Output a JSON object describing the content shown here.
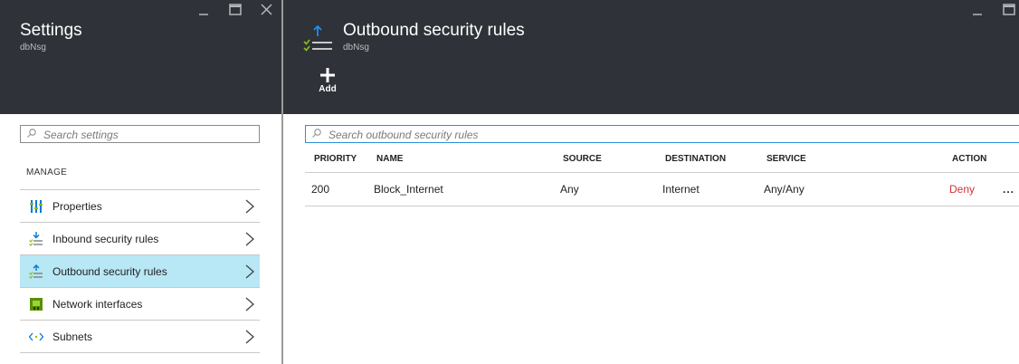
{
  "left_blade": {
    "title": "Settings",
    "subtitle": "dbNsg",
    "search_placeholder": "Search settings",
    "section_label": "MANAGE",
    "menu": [
      {
        "label": "Properties",
        "icon": "properties-icon"
      },
      {
        "label": "Inbound security rules",
        "icon": "inbound-rules-icon"
      },
      {
        "label": "Outbound security rules",
        "icon": "outbound-rules-icon",
        "selected": true
      },
      {
        "label": "Network interfaces",
        "icon": "network-interface-icon"
      },
      {
        "label": "Subnets",
        "icon": "subnet-icon"
      }
    ]
  },
  "right_blade": {
    "title": "Outbound security rules",
    "subtitle": "dbNsg",
    "add_label": "Add",
    "search_placeholder": "Search outbound security rules",
    "table": {
      "headers": [
        "PRIORITY",
        "NAME",
        "SOURCE",
        "DESTINATION",
        "SERVICE",
        "ACTION"
      ],
      "rows": [
        {
          "priority": "200",
          "name": "Block_Internet",
          "source": "Any",
          "destination": "Internet",
          "service": "Any/Any",
          "action": "Deny",
          "more": "..."
        }
      ]
    }
  },
  "colors": {
    "header_bg": "#2f3238",
    "selected_bg": "#b8e7f5",
    "deny": "#d13438",
    "accent_blue": "#0078d7",
    "check_green": "#8cbd18"
  }
}
